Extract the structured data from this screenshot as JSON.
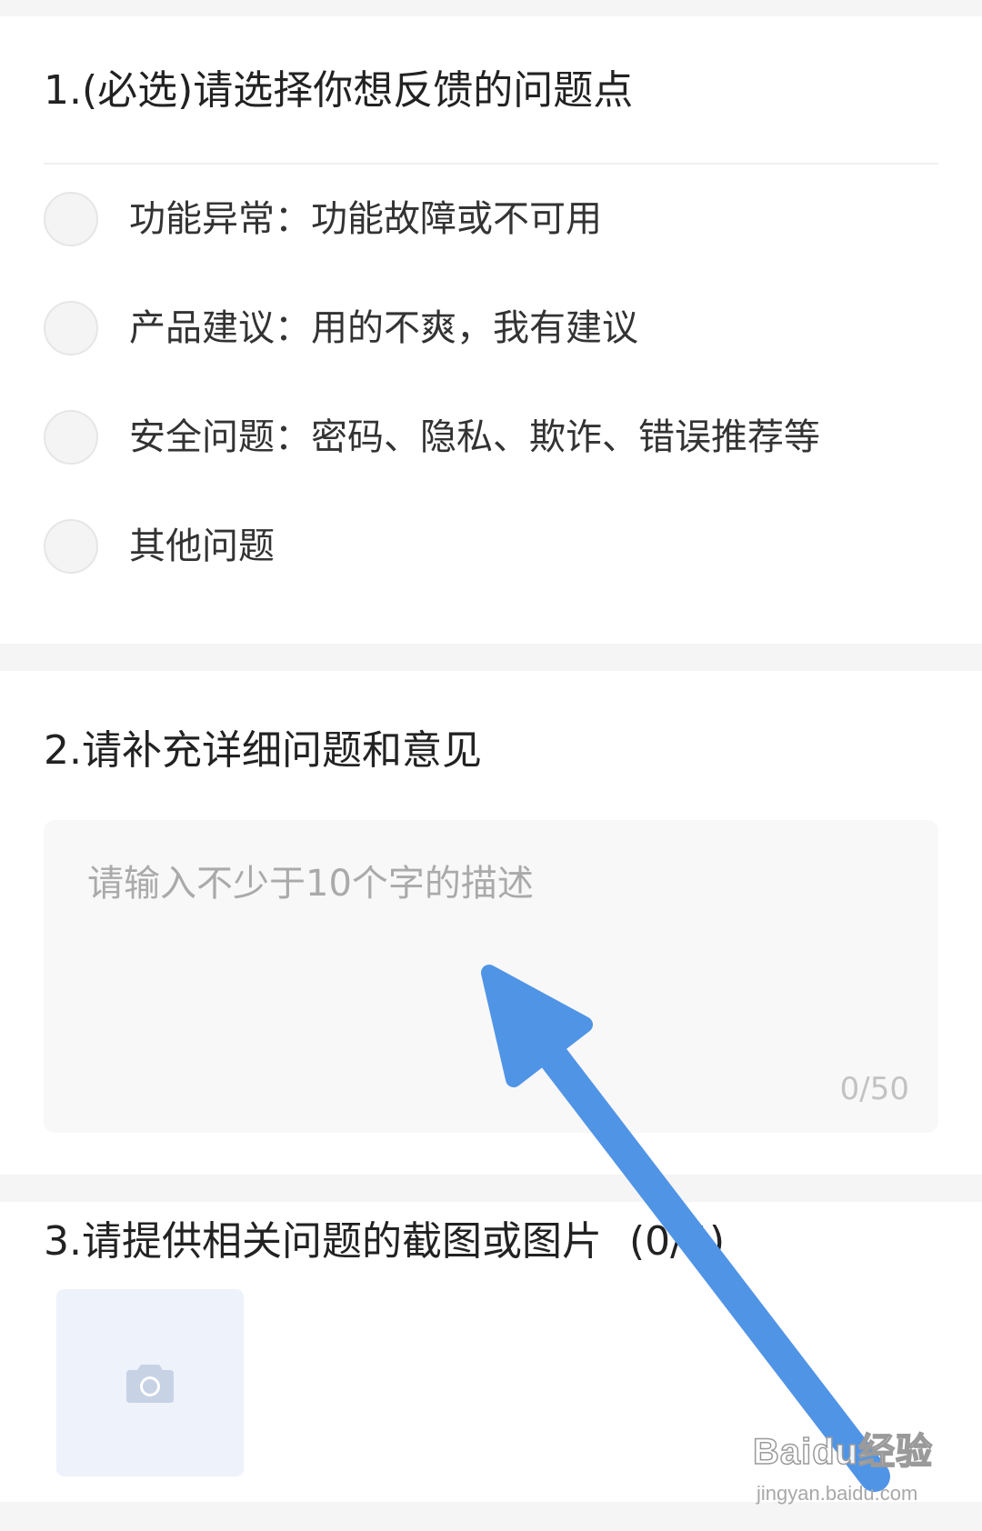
{
  "q1": {
    "title": "1.(必选)请选择你想反馈的问题点",
    "options": [
      {
        "label": "功能异常：功能故障或不可用"
      },
      {
        "label": "产品建议：用的不爽，我有建议"
      },
      {
        "label": "安全问题：密码、隐私、欺诈、错误推荐等"
      },
      {
        "label": "其他问题"
      }
    ]
  },
  "q2": {
    "title": "2.请补充详细问题和意见",
    "placeholder": "请输入不少于10个字的描述",
    "value": "",
    "counter": "0/50"
  },
  "q3": {
    "title": "3.请提供相关问题的截图或图片",
    "count": "(0/4)",
    "upload_icon": "camera-icon"
  },
  "watermark": {
    "brand": "Baidu经验",
    "url": "jingyan.baidu.com"
  },
  "colors": {
    "arrow": "#5094e6",
    "upload_bg": "#edf2fb",
    "camera": "#c7d2e5",
    "placeholder": "#aaaaaa"
  }
}
